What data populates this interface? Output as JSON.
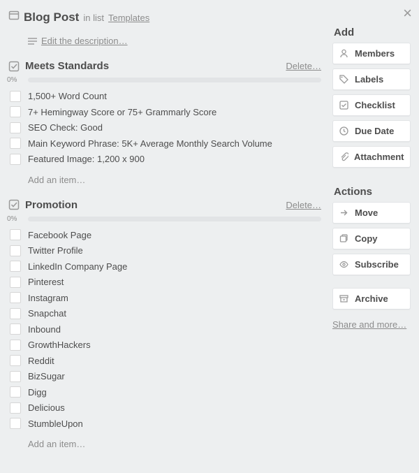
{
  "header": {
    "title": "Blog Post",
    "in_list_label": "in list",
    "list_name": "Templates",
    "edit_description": "Edit the description…"
  },
  "checklists": [
    {
      "title": "Meets Standards",
      "delete_label": "Delete…",
      "percent": "0%",
      "items": [
        "1,500+ Word Count",
        "7+ Hemingway Score or 75+ Grammarly Score",
        "SEO Check: Good",
        "Main Keyword Phrase: 5K+ Average Monthly Search Volume",
        "Featured Image: 1,200 x 900"
      ],
      "add_item": "Add an item…"
    },
    {
      "title": "Promotion",
      "delete_label": "Delete…",
      "percent": "0%",
      "items": [
        "Facebook Page",
        "Twitter Profile",
        "LinkedIn Company Page",
        "Pinterest",
        "Instagram",
        "Snapchat",
        "Inbound",
        "GrowthHackers",
        "Reddit",
        "BizSugar",
        "Digg",
        "Delicious",
        "StumbleUpon"
      ],
      "add_item": "Add an item…"
    }
  ],
  "sidebar": {
    "add_section": "Add",
    "add_buttons": {
      "members": "Members",
      "labels": "Labels",
      "checklist": "Checklist",
      "due_date": "Due Date",
      "attachment": "Attachment"
    },
    "actions_section": "Actions",
    "action_buttons": {
      "move": "Move",
      "copy": "Copy",
      "subscribe": "Subscribe",
      "archive": "Archive"
    },
    "share": "Share and more…"
  }
}
